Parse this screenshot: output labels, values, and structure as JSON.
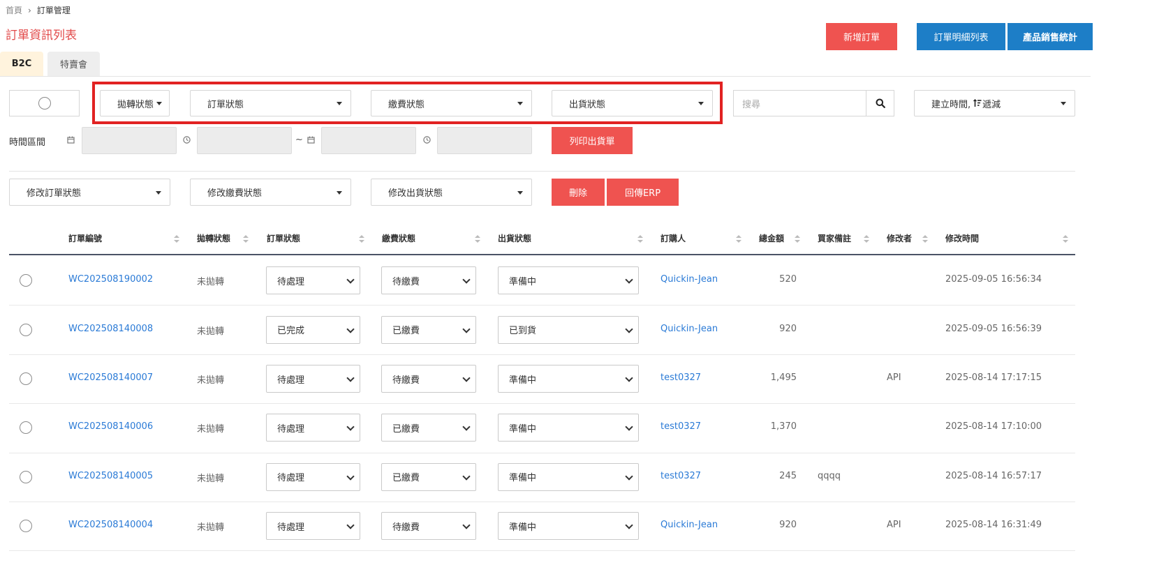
{
  "breadcrumb": {
    "home": "首頁",
    "separator": "›",
    "current": "訂單管理"
  },
  "page_title": "訂單資訊列表",
  "header_buttons": {
    "new_order": "新增訂單",
    "order_detail_list": "訂單明細列表",
    "product_sales_stats": "產品銷售統計"
  },
  "tabs": [
    {
      "label": "B2C"
    },
    {
      "label": "特賣會"
    }
  ],
  "filters": {
    "transfer_status": "拋轉狀態",
    "order_status": "訂單狀態",
    "payment_status": "繳費狀態",
    "shipping_status": "出貨狀態",
    "search_placeholder": "搜尋",
    "sort_prefix": "建立時間,",
    "sort_suffix": "遞減",
    "time_range_label": "時間區間",
    "range_separator": "~",
    "print_shipping_button": "列印出貨單"
  },
  "bulk_actions": {
    "modify_order_status": "修改訂單狀態",
    "modify_payment_status": "修改繳費狀態",
    "modify_shipping_status": "修改出貨狀態",
    "delete_button": "刪除",
    "erp_button": "回傳ERP"
  },
  "table": {
    "headers": {
      "order_no": "訂單編號",
      "transfer": "拋轉狀態",
      "order_status": "訂單狀態",
      "payment": "繳費狀態",
      "shipping": "出貨狀態",
      "buyer": "訂購人",
      "total": "總金額",
      "buyer_note": "買家備註",
      "modifier": "修改者",
      "modified_time": "修改時間"
    },
    "rows": [
      {
        "order_no": "WC202508190002",
        "transfer": "未拋轉",
        "order_status": "待處理",
        "payment": "待繳費",
        "shipping": "準備中",
        "buyer": "Quickin-Jean",
        "total": "520",
        "note": "",
        "modifier": "",
        "time": "2025-09-05 16:56:34"
      },
      {
        "order_no": "WC202508140008",
        "transfer": "未拋轉",
        "order_status": "已完成",
        "payment": "已繳費",
        "shipping": "已到貨",
        "buyer": "Quickin-Jean",
        "total": "920",
        "note": "",
        "modifier": "",
        "time": "2025-09-05 16:56:39"
      },
      {
        "order_no": "WC202508140007",
        "transfer": "未拋轉",
        "order_status": "待處理",
        "payment": "待繳費",
        "shipping": "準備中",
        "buyer": "test0327",
        "total": "1,495",
        "note": "",
        "modifier": "API",
        "time": "2025-08-14 17:17:15"
      },
      {
        "order_no": "WC202508140006",
        "transfer": "未拋轉",
        "order_status": "待處理",
        "payment": "已繳費",
        "shipping": "準備中",
        "buyer": "test0327",
        "total": "1,370",
        "note": "",
        "modifier": "",
        "time": "2025-08-14 17:10:00"
      },
      {
        "order_no": "WC202508140005",
        "transfer": "未拋轉",
        "order_status": "待處理",
        "payment": "已繳費",
        "shipping": "準備中",
        "buyer": "test0327",
        "total": "245",
        "note": "qqqq",
        "modifier": "",
        "time": "2025-08-14 16:57:17"
      },
      {
        "order_no": "WC202508140004",
        "transfer": "未拋轉",
        "order_status": "待處理",
        "payment": "待繳費",
        "shipping": "準備中",
        "buyer": "Quickin-Jean",
        "total": "920",
        "note": "",
        "modifier": "API",
        "time": "2025-08-14 16:31:49"
      }
    ]
  },
  "colors": {
    "accent_red": "#ef5350",
    "brand_blue": "#1d7ec7",
    "link_blue": "#2a7ad6",
    "highlight_border": "#e12222"
  }
}
